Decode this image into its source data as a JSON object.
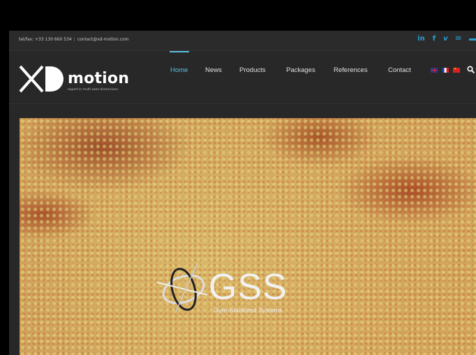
{
  "topbar": {
    "tel": "tel/fax: +33 130 660 534",
    "separator": "|",
    "email": "contact@xd-motion.com",
    "social_icons": [
      "linkedin-icon",
      "facebook-icon",
      "vimeo-icon",
      "mail-icon",
      "menu-bar-icon"
    ],
    "social_labels": {
      "linkedin": "in",
      "facebook": "f",
      "vimeo": "v",
      "mail": "✉"
    }
  },
  "logo": {
    "word": "motion",
    "tagline": "expert in multi axes dimensions"
  },
  "nav": {
    "items": [
      {
        "label": "Home",
        "active": true
      },
      {
        "label": "News",
        "active": false
      },
      {
        "label": "Products",
        "active": false
      },
      {
        "label": "Packages",
        "active": false
      },
      {
        "label": "References",
        "active": false
      },
      {
        "label": "Contact",
        "active": false
      }
    ],
    "languages": [
      "flag-uk-icon",
      "flag-fr-icon",
      "flag-cn-icon"
    ],
    "search_glyph": "🔍"
  },
  "hero": {
    "brand": "GSS",
    "subtitle": "Gyro-Stabilized Systems"
  },
  "colors": {
    "accent": "#5bc0de",
    "social": "#2a9fd6",
    "background": "#282828"
  }
}
